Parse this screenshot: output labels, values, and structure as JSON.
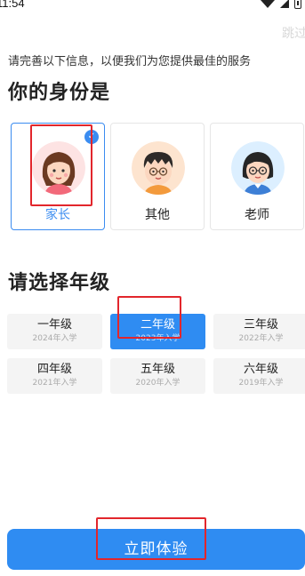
{
  "status_bar": {
    "time": "11:54"
  },
  "skip_label": "跳过",
  "subtitle": "请完善以下信息，以便我们为您提供最佳的服务",
  "identity": {
    "title": "你的身份是",
    "cards": [
      {
        "label": "家长",
        "avatar": "woman-avatar-icon",
        "selected": true
      },
      {
        "label": "其他",
        "avatar": "boy-avatar-icon",
        "selected": false
      },
      {
        "label": "老师",
        "avatar": "teacher-avatar-icon",
        "selected": false
      }
    ]
  },
  "grade": {
    "title": "请选择年级",
    "items": [
      {
        "name": "一年级",
        "year": "2024年入学",
        "selected": false
      },
      {
        "name": "二年级",
        "year": "2023年入学",
        "selected": true
      },
      {
        "name": "三年级",
        "year": "2022年入学",
        "selected": false
      },
      {
        "name": "四年级",
        "year": "2021年入学",
        "selected": false
      },
      {
        "name": "五年级",
        "year": "2020年入学",
        "selected": false
      },
      {
        "name": "六年级",
        "year": "2019年入学",
        "selected": false
      }
    ]
  },
  "start_button": "立即体验",
  "colors": {
    "accent": "#2f8cf2",
    "highlight_box": "#e2262c"
  }
}
